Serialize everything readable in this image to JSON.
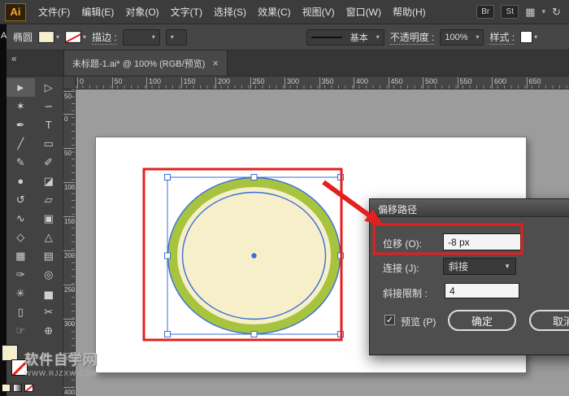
{
  "menubar": {
    "logo": "Ai",
    "items": [
      {
        "label": "文件(F)"
      },
      {
        "label": "编辑(E)"
      },
      {
        "label": "对象(O)"
      },
      {
        "label": "文字(T)"
      },
      {
        "label": "选择(S)"
      },
      {
        "label": "效果(C)"
      },
      {
        "label": "视图(V)"
      },
      {
        "label": "窗口(W)"
      },
      {
        "label": "帮助(H)"
      }
    ],
    "bridge_label": "Br",
    "stock_label": "St"
  },
  "controlbar": {
    "shape_label": "椭圆",
    "stroke_label": "描边 :",
    "profile_label": "基本",
    "opacity_label": "不透明度 :",
    "opacity_value": "100%",
    "style_label": "样式 :"
  },
  "tabbar": {
    "collapse": "«",
    "tab_title": "未标题-1.ai* @ 100% (RGB/预览)",
    "close": "×"
  },
  "rulers": {
    "horizontal": [
      "0",
      "50",
      "100",
      "150",
      "200",
      "250",
      "300",
      "350",
      "400",
      "450",
      "500",
      "550",
      "600",
      "650"
    ],
    "vertical": [
      "50",
      "0",
      "50",
      "100",
      "150",
      "200",
      "250",
      "300",
      "350",
      "400"
    ]
  },
  "toolbar": {
    "tools": [
      {
        "name": "selection-tool",
        "glyph": "►"
      },
      {
        "name": "direct-selection-tool",
        "glyph": "▷"
      },
      {
        "name": "magic-wand-tool",
        "glyph": "✶"
      },
      {
        "name": "lasso-tool",
        "glyph": "∽"
      },
      {
        "name": "pen-tool",
        "glyph": "✒"
      },
      {
        "name": "type-tool",
        "glyph": "T"
      },
      {
        "name": "line-segment-tool",
        "glyph": "╱"
      },
      {
        "name": "rectangle-tool",
        "glyph": "▭"
      },
      {
        "name": "paintbrush-tool",
        "glyph": "✎"
      },
      {
        "name": "pencil-tool",
        "glyph": "✐"
      },
      {
        "name": "blob-brush-tool",
        "glyph": "●"
      },
      {
        "name": "eraser-tool",
        "glyph": "◪"
      },
      {
        "name": "rotate-tool",
        "glyph": "↺"
      },
      {
        "name": "scale-tool",
        "glyph": "▱"
      },
      {
        "name": "width-tool",
        "glyph": "∿"
      },
      {
        "name": "free-transform-tool",
        "glyph": "▣"
      },
      {
        "name": "shape-builder-tool",
        "glyph": "◇"
      },
      {
        "name": "perspective-grid-tool",
        "glyph": "△"
      },
      {
        "name": "mesh-tool",
        "glyph": "▦"
      },
      {
        "name": "gradient-tool",
        "glyph": "▤"
      },
      {
        "name": "eyedropper-tool",
        "glyph": "✑"
      },
      {
        "name": "blend-tool",
        "glyph": "◎"
      },
      {
        "name": "symbol-sprayer-tool",
        "glyph": "✳"
      },
      {
        "name": "column-graph-tool",
        "glyph": "▅"
      },
      {
        "name": "artboard-tool",
        "glyph": "▯"
      },
      {
        "name": "slice-tool",
        "glyph": "✂"
      },
      {
        "name": "hand-tool",
        "glyph": "☞"
      },
      {
        "name": "zoom-tool",
        "glyph": "⊕"
      }
    ]
  },
  "dialog": {
    "title": "偏移路径",
    "offset_label": "位移 (O):",
    "offset_value": "-8 px",
    "join_label": "连接 (J):",
    "join_value": "斜接",
    "miter_label": "斜接限制 :",
    "miter_value": "4",
    "preview_label": "预览 (P)",
    "checkmark": "✓",
    "ok_label": "确定",
    "cancel_label": "取消"
  },
  "watermark": {
    "title": "软件自学网",
    "url": "WWW.RJZXW.COM"
  },
  "icons": {
    "caret_down": "▾",
    "caret_down_solid": "▼",
    "grid": "▦",
    "sync": "↻"
  },
  "misc": {
    "edge_text": "A"
  },
  "colors": {
    "ellipse_fill": "#f6efca",
    "ellipse_stroke": "#a8c33e",
    "selection": "#3a6fd8",
    "annotation": "#e3201d"
  }
}
